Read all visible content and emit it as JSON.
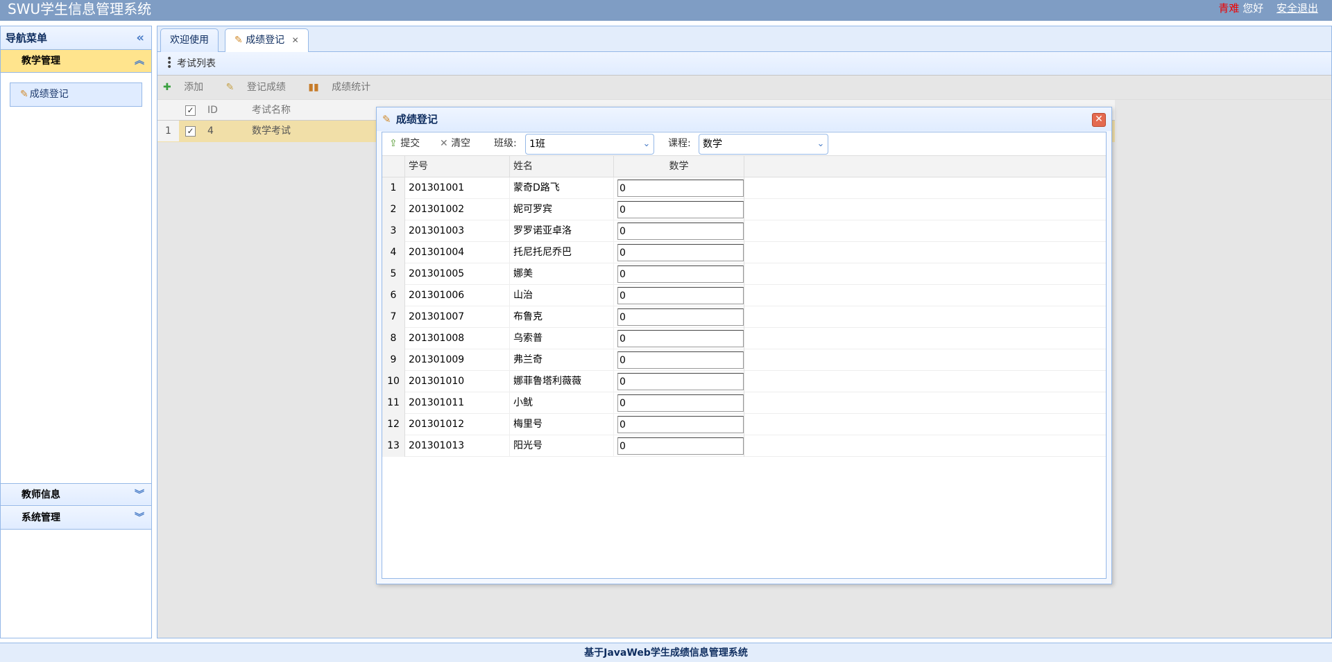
{
  "header": {
    "title": "SWU学生信息管理系统",
    "user": "青难",
    "greeting": "您好",
    "logout": "安全退出"
  },
  "sidebar": {
    "title": "导航菜单",
    "sections": [
      {
        "label": "教学管理"
      },
      {
        "label": "教师信息"
      },
      {
        "label": "系统管理"
      }
    ],
    "items": [
      {
        "label": "成绩登记"
      }
    ]
  },
  "tabs": [
    {
      "label": "欢迎使用"
    },
    {
      "label": "成绩登记"
    }
  ],
  "exam_panel": {
    "title": "考试列表",
    "toolbar": {
      "add": "添加",
      "register": "登记成绩",
      "stats": "成绩统计"
    },
    "columns": {
      "id": "ID",
      "name": "考试名称"
    },
    "rows": [
      {
        "rownum": "1",
        "id": "4",
        "name": "数学考试"
      }
    ]
  },
  "dialog": {
    "title": "成绩登记",
    "toolbar": {
      "submit": "提交",
      "clear": "清空",
      "class_label": "班级:",
      "class_value": "1班",
      "course_label": "课程:",
      "course_value": "数学"
    },
    "columns": {
      "student_id": "学号",
      "name": "姓名",
      "score": "数学"
    },
    "students": [
      {
        "rownum": "1",
        "id": "201301001",
        "name": "蒙奇D路飞",
        "score": "0"
      },
      {
        "rownum": "2",
        "id": "201301002",
        "name": "妮可罗宾",
        "score": "0"
      },
      {
        "rownum": "3",
        "id": "201301003",
        "name": "罗罗诺亚卓洛",
        "score": "0"
      },
      {
        "rownum": "4",
        "id": "201301004",
        "name": "托尼托尼乔巴",
        "score": "0"
      },
      {
        "rownum": "5",
        "id": "201301005",
        "name": "娜美",
        "score": "0"
      },
      {
        "rownum": "6",
        "id": "201301006",
        "name": "山治",
        "score": "0"
      },
      {
        "rownum": "7",
        "id": "201301007",
        "name": "布鲁克",
        "score": "0"
      },
      {
        "rownum": "8",
        "id": "201301008",
        "name": "乌索普",
        "score": "0"
      },
      {
        "rownum": "9",
        "id": "201301009",
        "name": "弗兰奇",
        "score": "0"
      },
      {
        "rownum": "10",
        "id": "201301010",
        "name": "娜菲鲁塔利薇薇",
        "score": "0"
      },
      {
        "rownum": "11",
        "id": "201301011",
        "name": "小鱿",
        "score": "0"
      },
      {
        "rownum": "12",
        "id": "201301012",
        "name": "梅里号",
        "score": "0"
      },
      {
        "rownum": "13",
        "id": "201301013",
        "name": "阳光号",
        "score": "0"
      }
    ]
  },
  "footer": {
    "text": "基于JavaWeb学生成绩信息管理系统"
  },
  "icons": {
    "collapse": "double-chevron-left-icon",
    "expand": "double-chevron-down-icon",
    "edit": "pencil-icon",
    "close": "close-icon",
    "add": "plus-icon",
    "stats": "bar-chart-icon",
    "submit": "upload-icon",
    "clear": "x-icon"
  },
  "colors": {
    "header_bg": "#7f9dc4",
    "selected_accent": "#ffe48d",
    "user_name": "#ee0000",
    "border": "#95b8e7"
  }
}
